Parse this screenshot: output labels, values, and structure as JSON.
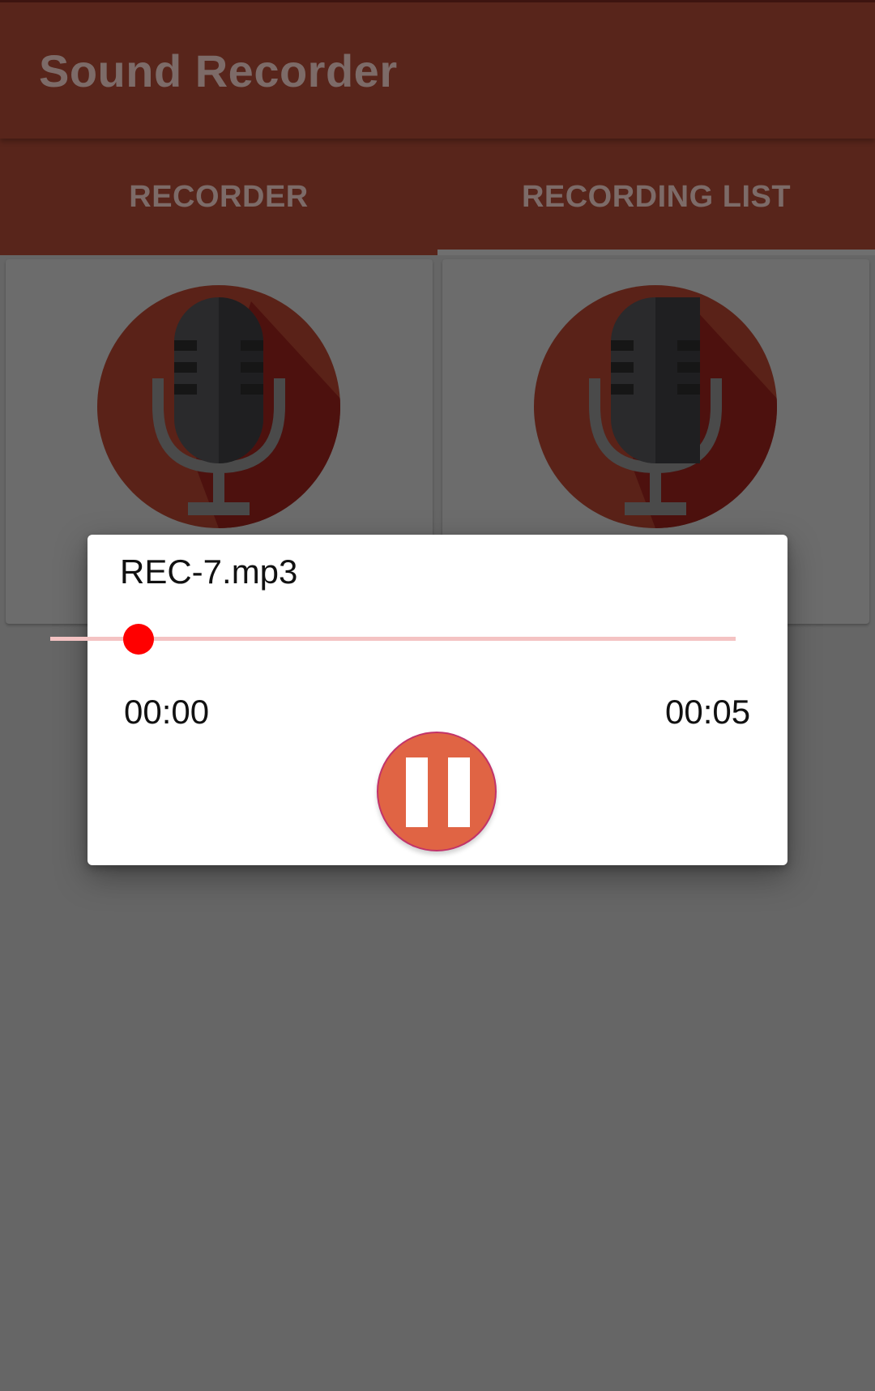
{
  "app": {
    "title": "Sound Recorder"
  },
  "tabs": [
    {
      "label": "RECORDER"
    },
    {
      "label": "RECORDING LIST"
    }
  ],
  "colors": {
    "app_bar": "#58251b",
    "scrim": "#666666",
    "mic_circle": "#5a2218",
    "seek_thumb": "#ff0000",
    "seek_track": "#f4c3c3",
    "pause_button": "#e06444"
  },
  "cards": [
    {
      "icon": "microphone-icon"
    },
    {
      "icon": "microphone-icon"
    }
  ],
  "player_dialog": {
    "file_name": "REC-7.mp3",
    "elapsed": "00:00",
    "total": "00:05",
    "progress": 0,
    "control_icon": "pause-icon"
  }
}
